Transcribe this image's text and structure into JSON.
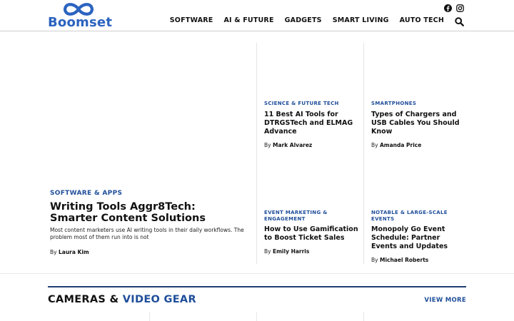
{
  "brand": {
    "name": "Boomset",
    "color": "#2b63c0"
  },
  "header": {
    "social": [
      {
        "icon": "facebook-icon"
      },
      {
        "icon": "instagram-icon"
      }
    ],
    "nav": [
      "SOFTWARE",
      "AI & FUTURE",
      "GADGETS",
      "SMART LIVING",
      "AUTO TECH"
    ],
    "search_icon": "search-icon"
  },
  "featured": {
    "category": "SOFTWARE & APPS",
    "title": "Writing Tools Aggr8Tech: Smarter Content Solutions",
    "excerpt": "Most content marketers use AI writing tools in their daily workflows. The problem most of them run into is not",
    "by": "By",
    "author": "Laura Kim"
  },
  "cards": [
    {
      "category": "SCIENCE & FUTURE TECH",
      "title": "11 Best AI Tools for DTRGSTech and ELMAG Advance",
      "by": "By",
      "author": "Mark Alvarez"
    },
    {
      "category": "SMARTPHONES",
      "title": "Types of Chargers and USB Cables You Should Know",
      "by": "By",
      "author": "Amanda Price"
    },
    {
      "category": "EVENT MARKETING & ENGAGEMENT",
      "title": "How to Use Gamification to Boost Ticket Sales",
      "by": "By",
      "author": "Emily Harris"
    },
    {
      "category": "NOTABLE & LARGE-SCALE EVENTS",
      "title": "Monopoly Go Event Schedule: Partner Events and Updates",
      "by": "By",
      "author": "Michael Roberts"
    }
  ],
  "section": {
    "title_plain": "CAMERAS & ",
    "title_accent": "VIDEO GEAR",
    "view_more": "VIEW MORE"
  },
  "colors": {
    "accent": "#1f4e9a",
    "rule": "#1f3f74"
  }
}
